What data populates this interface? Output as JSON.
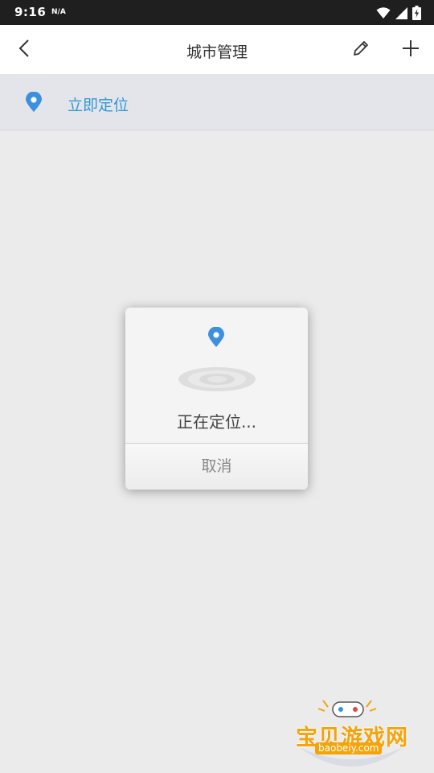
{
  "status_bar": {
    "time": "9:16",
    "network": "N/A",
    "icons": [
      "wifi-icon",
      "cell-signal-icon",
      "battery-charging-icon"
    ]
  },
  "app_bar": {
    "title": "城市管理",
    "icons": [
      "back-arrow-icon",
      "pencil-icon",
      "plus-icon"
    ]
  },
  "locate_row": {
    "label": "立即定位",
    "icon": "location-pin-icon"
  },
  "dialog": {
    "message": "正在定位...",
    "cancel_label": "取消",
    "icons": [
      "location-pin-icon",
      "radar-rings-icon"
    ]
  },
  "watermark": {
    "title": "宝贝游戏网",
    "subtitle": "baobeiy.com"
  },
  "colors": {
    "accent": "#2c98d8",
    "pin": "#3d8fe0",
    "status_bar": "#1f1f1f",
    "background": "#ebebeb",
    "watermark": "#f5a30a"
  }
}
